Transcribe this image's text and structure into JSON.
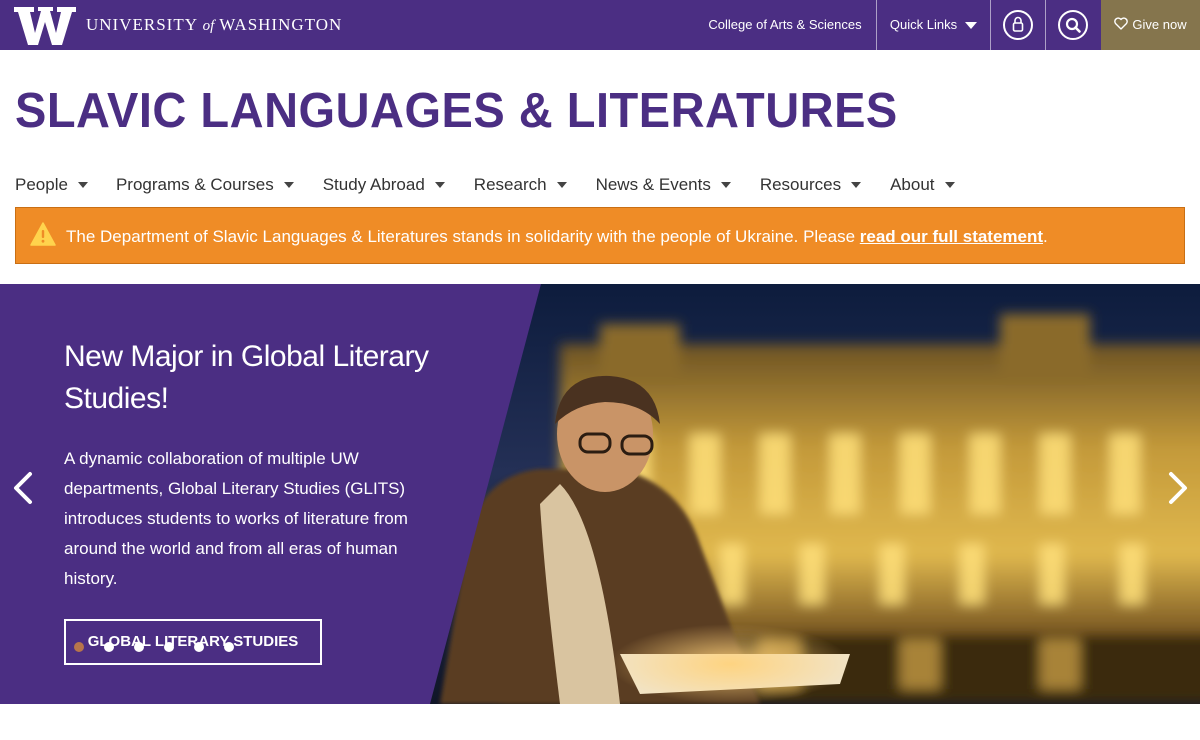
{
  "brand": {
    "wordmark_pre": "UNIVERSITY",
    "wordmark_of": "of",
    "wordmark_post": "WASHINGTON",
    "purple": "#4b2e83",
    "gold": "#85754d"
  },
  "topnav": {
    "college_label": "College of Arts & Sciences",
    "quicklinks_label": "Quick Links",
    "give_label": "Give now",
    "account_icon": "user-icon",
    "search_icon": "search-icon",
    "heart_icon": "heart-icon"
  },
  "site": {
    "title": "SLAVIC LANGUAGES & LITERATURES"
  },
  "mainnav": {
    "items": [
      {
        "label": "People"
      },
      {
        "label": "Programs & Courses"
      },
      {
        "label": "Study Abroad"
      },
      {
        "label": "Research"
      },
      {
        "label": "News & Events"
      },
      {
        "label": "Resources"
      },
      {
        "label": "About"
      }
    ]
  },
  "alert": {
    "text": "The Department of Slavic Languages & Literatures stands in solidarity with the people of Ukraine. Please ",
    "link_text": "read our full statement",
    "suffix": ".",
    "color": "#ef8c26",
    "icon": "warning-icon"
  },
  "hero": {
    "title": "New Major in Global Literary Studies!",
    "body": "A dynamic collaboration of multiple UW departments, Global Literary Studies (GLITS) introduces students to works of literature from around the world and from all eras of human history.",
    "button_label": "GLOBAL LITERARY STUDIES",
    "prev_icon": "chevron-left-icon",
    "next_icon": "chevron-right-icon",
    "slide_count": 6,
    "active_slide": 1
  }
}
